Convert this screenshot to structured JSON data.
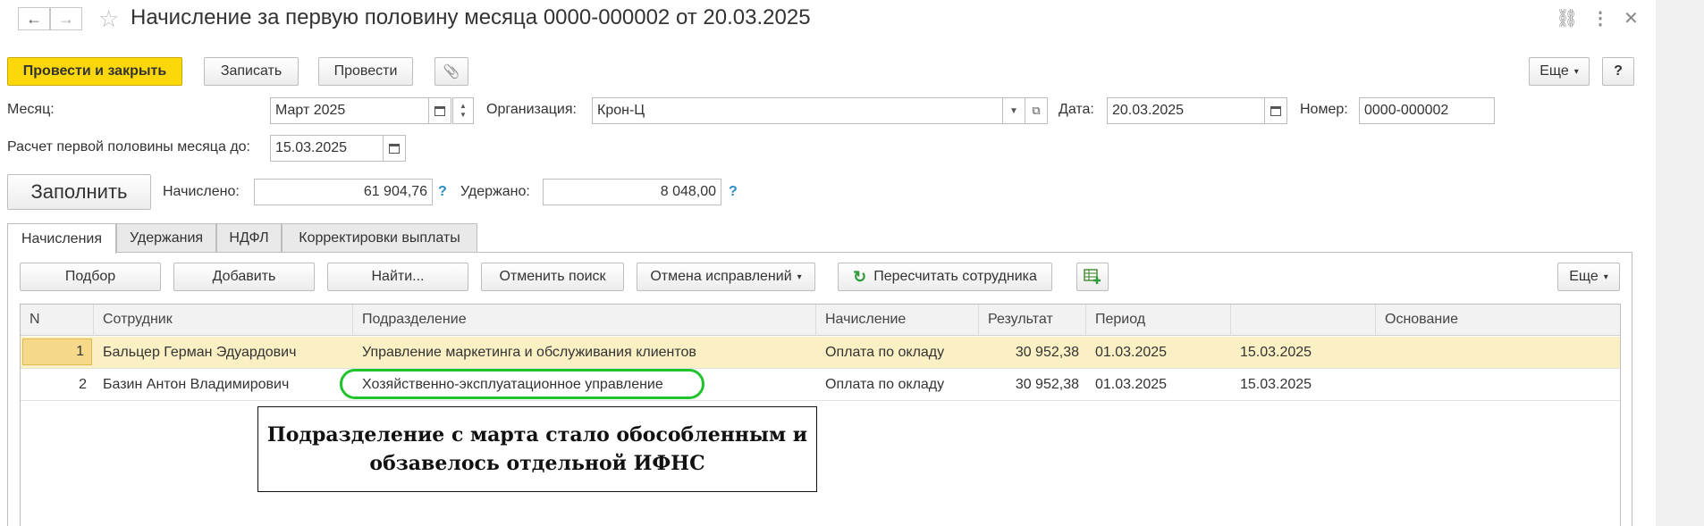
{
  "header": {
    "title": "Начисление за первую половину месяца 0000-000002 от 20.03.2025",
    "back_icon": "←",
    "forward_icon": "→",
    "favorite_icon": "☆",
    "link_icon": "⛓",
    "more_icon": "⋮",
    "close_icon": "✕"
  },
  "toolbar": {
    "post_close": "Провести и закрыть",
    "save": "Записать",
    "post": "Провести",
    "attach_icon": "📎",
    "more": "Еще",
    "help": "?"
  },
  "form": {
    "month_label": "Месяц:",
    "month_value": "Март 2025",
    "org_label": "Организация:",
    "org_value": "Крон-Ц",
    "date_label": "Дата:",
    "date_value": "20.03.2025",
    "number_label": "Номер:",
    "number_value": "0000-000002",
    "calc_until_label": "Расчет первой половины месяца до:",
    "calc_until_value": "15.03.2025",
    "fill_button": "Заполнить",
    "accrued_label": "Начислено:",
    "accrued_value": "61 904,76",
    "withheld_label": "Удержано:",
    "withheld_value": "8 048,00",
    "help_mark": "?"
  },
  "tabs": [
    "Начисления",
    "Удержания",
    "НДФЛ",
    "Корректировки выплаты"
  ],
  "table_toolbar": {
    "select": "Подбор",
    "add": "Добавить",
    "find": "Найти...",
    "cancel_search": "Отменить поиск",
    "cancel_corrections": "Отмена исправлений",
    "recalc": "Пересчитать сотрудника",
    "more": "Еще"
  },
  "table": {
    "columns": [
      "N",
      "Сотрудник",
      "Подразделение",
      "Начисление",
      "Результат",
      "Период",
      "",
      "Основание"
    ],
    "rows": [
      [
        "1",
        "Бальцер Герман Эдуардович",
        "Управление маркетинга и обслуживания клиентов",
        "Оплата по окладу",
        "30 952,38",
        "01.03.2025",
        "15.03.2025",
        ""
      ],
      [
        "2",
        "Базин Антон Владимирович",
        "Хозяйственно-эксплуатационное управление",
        "Оплата по окладу",
        "30 952,38",
        "01.03.2025",
        "15.03.2025",
        ""
      ]
    ]
  },
  "annotation": {
    "line1": "Подразделение с марта стало обособленным и",
    "line2": "обзавелось отдельной ИФНС"
  },
  "colors": {
    "primary_button": "#fcd80a",
    "selected_row": "#fbefc4",
    "highlight_oval": "#21c32a",
    "help_blue": "#2a8cc2"
  }
}
